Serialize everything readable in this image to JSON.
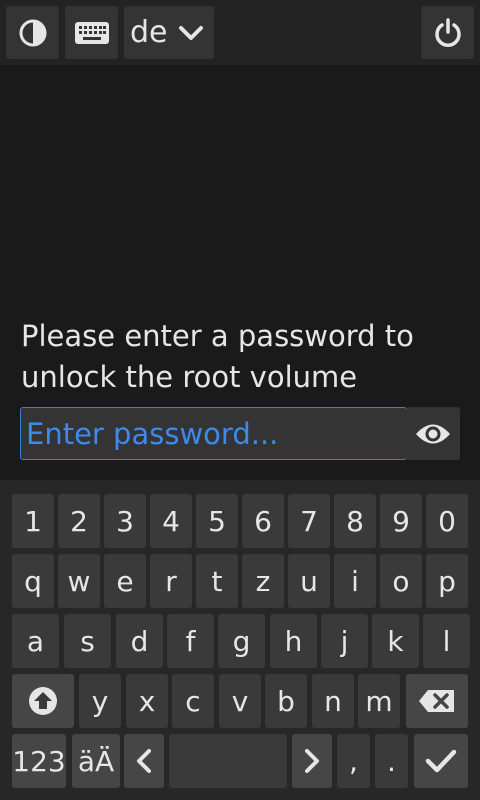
{
  "topbar": {
    "layout_label": "de",
    "icons": [
      "contrast-icon",
      "keyboard-icon",
      "chevron-down-icon",
      "power-icon"
    ]
  },
  "prompt": {
    "text": "Please enter a password to unlock the root volume",
    "placeholder": "Enter password...",
    "value": ""
  },
  "keyboard": {
    "row1": [
      "1",
      "2",
      "3",
      "4",
      "5",
      "6",
      "7",
      "8",
      "9",
      "0"
    ],
    "row2": [
      "q",
      "w",
      "e",
      "r",
      "t",
      "z",
      "u",
      "i",
      "o",
      "p"
    ],
    "row3": [
      "a",
      "s",
      "d",
      "f",
      "g",
      "h",
      "j",
      "k",
      "l"
    ],
    "row4": [
      "y",
      "x",
      "c",
      "v",
      "b",
      "n",
      "m"
    ],
    "numbers_label": "123",
    "umlaut_label": "äÄ",
    "comma": ",",
    "period": "."
  },
  "colors": {
    "accent": "#3d8aed",
    "background": "#1a1a1a",
    "key": "#3a3a3a"
  }
}
